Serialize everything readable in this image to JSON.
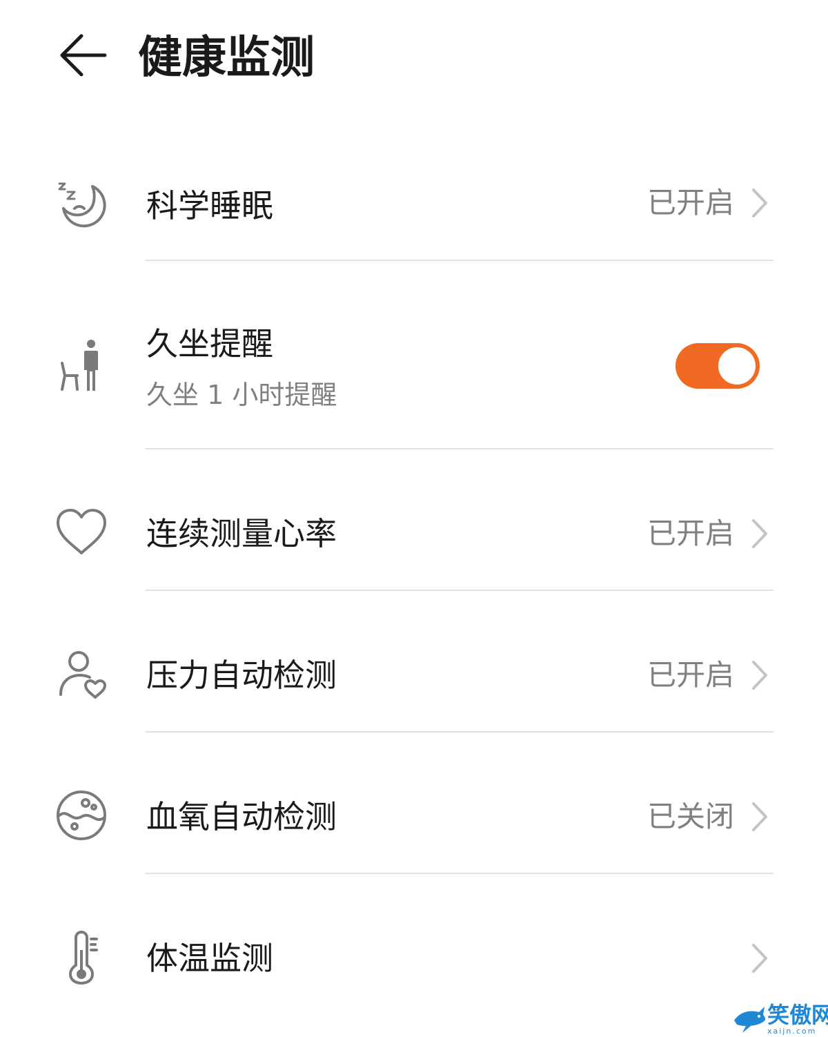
{
  "header": {
    "title": "健康监测",
    "back_icon": "arrow-left-icon"
  },
  "rows": [
    {
      "id": "sleep",
      "icon": "sleep-moon-icon",
      "label": "科学睡眠",
      "status": "已开启"
    },
    {
      "id": "sedentary",
      "icon": "person-chair-icon",
      "label": "久坐提醒",
      "sub": "久坐 1 小时提醒",
      "toggle_on": true
    },
    {
      "id": "heart",
      "icon": "heart-icon",
      "label": "连续测量心率",
      "status": "已开启"
    },
    {
      "id": "stress",
      "icon": "person-heart-icon",
      "label": "压力自动检测",
      "status": "已开启"
    },
    {
      "id": "spo2",
      "icon": "blood-oxygen-icon",
      "label": "血氧自动检测",
      "status": "已关闭"
    },
    {
      "id": "temp",
      "icon": "thermometer-icon",
      "label": "体温监测",
      "status": ""
    }
  ],
  "colors": {
    "accent": "#f06a23",
    "text_primary": "#1a1a1a",
    "text_secondary": "#808080",
    "divider": "#e3e3e3",
    "icon_gray": "#7a7a7a",
    "watermark": "#1e88d6"
  },
  "watermark": {
    "text": "笑傲网",
    "sub": "xaijn.com"
  }
}
